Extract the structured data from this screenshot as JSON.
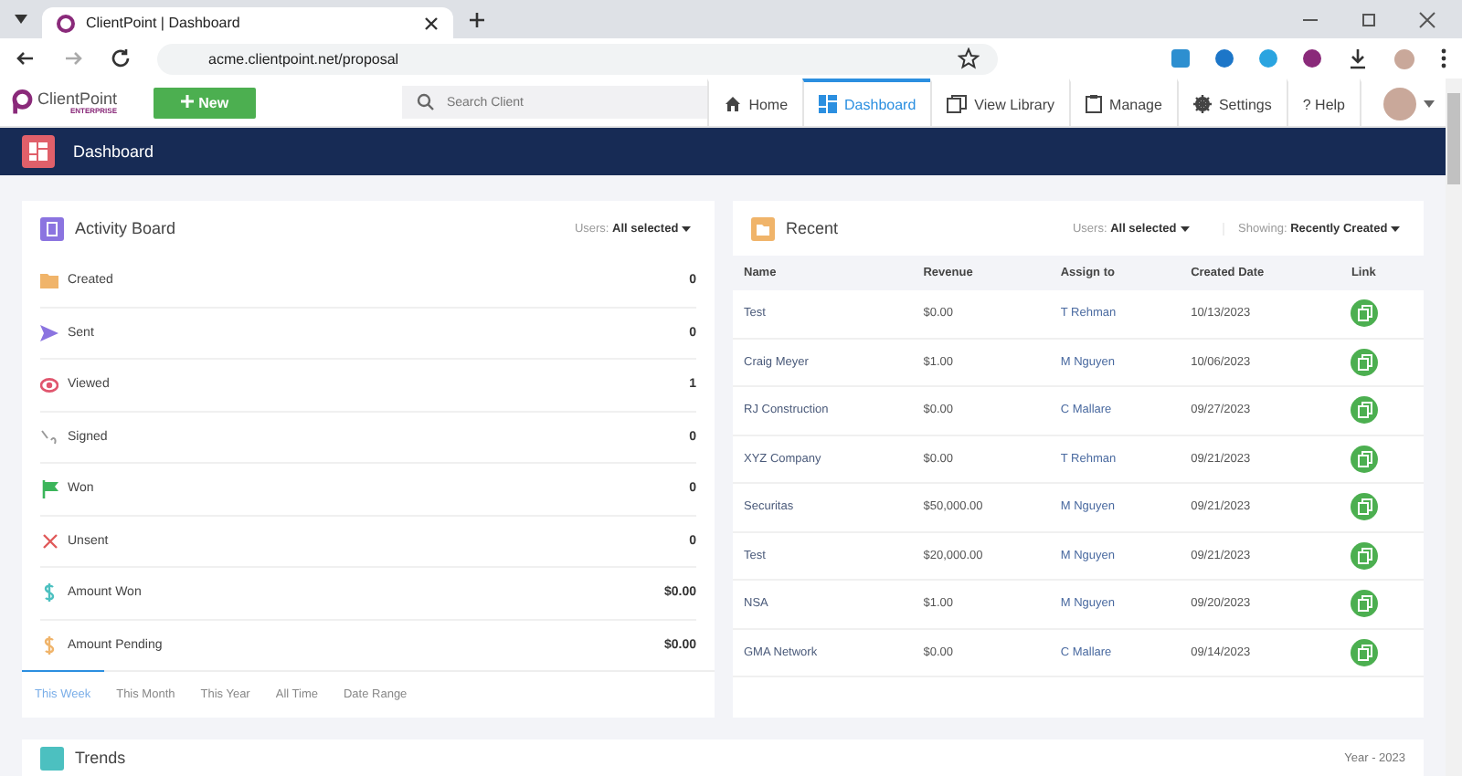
{
  "browser": {
    "tab_title": "ClientPoint | Dashboard",
    "url": "acme.clientpoint.net/proposal"
  },
  "header": {
    "logo": "ClientPoint",
    "logo_sub": "ENTERPRISE",
    "new_button": "New",
    "search": {
      "placeholder": "Search Client"
    },
    "nav": [
      {
        "label": "Home",
        "selected": false
      },
      {
        "label": "Dashboard",
        "selected": true
      },
      {
        "label": "View Library",
        "selected": false
      },
      {
        "label": "Manage",
        "selected": false
      },
      {
        "label": "Settings",
        "selected": false
      },
      {
        "label": "? Help",
        "selected": false
      }
    ]
  },
  "page_title": "Dashboard",
  "activity_board": {
    "title": "Activity Board",
    "users_label": "Users:",
    "users_value": "All selected",
    "rows": [
      {
        "kind": "created",
        "label": "Created",
        "value": "0"
      },
      {
        "kind": "sent",
        "label": "Sent",
        "value": "0"
      },
      {
        "kind": "viewed",
        "label": "Viewed",
        "value": "1"
      },
      {
        "kind": "signed",
        "label": "Signed",
        "value": "0"
      },
      {
        "kind": "won",
        "label": "Won",
        "value": "0"
      },
      {
        "kind": "unsent",
        "label": "Unsent",
        "value": "0"
      },
      {
        "kind": "amount_won",
        "label": "Amount Won",
        "value": "$0.00"
      },
      {
        "kind": "amount_pending",
        "label": "Amount Pending",
        "value": "$0.00"
      }
    ],
    "tabs": [
      {
        "label": "This Week",
        "selected": true
      },
      {
        "label": "This Month",
        "selected": false
      },
      {
        "label": "This Year",
        "selected": false
      },
      {
        "label": "All Time",
        "selected": false
      },
      {
        "label": "Date Range",
        "selected": false
      }
    ]
  },
  "recent": {
    "title": "Recent",
    "users_label": "Users:",
    "users_value": "All selected",
    "showing_label": "Showing:",
    "showing_value": "Recently Created",
    "columns": [
      "Name",
      "Revenue",
      "Assign to",
      "Created Date",
      "Link"
    ],
    "rows": [
      {
        "name": "Test",
        "revenue": "$0.00",
        "assign_to": "T Rehman",
        "created_date": "10/13/2023"
      },
      {
        "name": "Craig Meyer",
        "revenue": "$1.00",
        "assign_to": "M Nguyen",
        "created_date": "10/06/2023"
      },
      {
        "name": "RJ Construction",
        "revenue": "$0.00",
        "assign_to": "C Mallare",
        "created_date": "09/27/2023"
      },
      {
        "name": "XYZ Company",
        "revenue": "$0.00",
        "assign_to": "T Rehman",
        "created_date": "09/21/2023"
      },
      {
        "name": "Securitas",
        "revenue": "$50,000.00",
        "assign_to": "M Nguyen",
        "created_date": "09/21/2023"
      },
      {
        "name": "Test",
        "revenue": "$20,000.00",
        "assign_to": "M Nguyen",
        "created_date": "09/21/2023"
      },
      {
        "name": "NSA",
        "revenue": "$1.00",
        "assign_to": "M Nguyen",
        "created_date": "09/20/2023"
      },
      {
        "name": "GMA Network",
        "revenue": "$0.00",
        "assign_to": "C Mallare",
        "created_date": "09/14/2023"
      }
    ]
  },
  "trends": {
    "title": "Trends",
    "period": "Year - 2023"
  }
}
